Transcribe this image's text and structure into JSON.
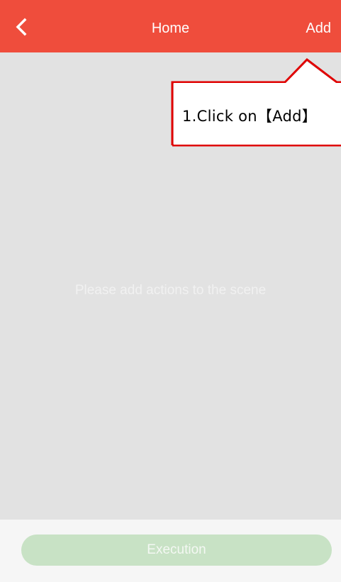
{
  "header": {
    "title": "Home",
    "add_label": "Add",
    "back_icon": "chevron-left-icon",
    "background_color": "#ef4d3c"
  },
  "main": {
    "empty_message": "Please add actions to the scene"
  },
  "footer": {
    "execution_label": "Execution",
    "button_color": "#c8e2c5"
  },
  "annotation": {
    "text": "1.Click on【Add】",
    "border_color": "#e00000"
  }
}
